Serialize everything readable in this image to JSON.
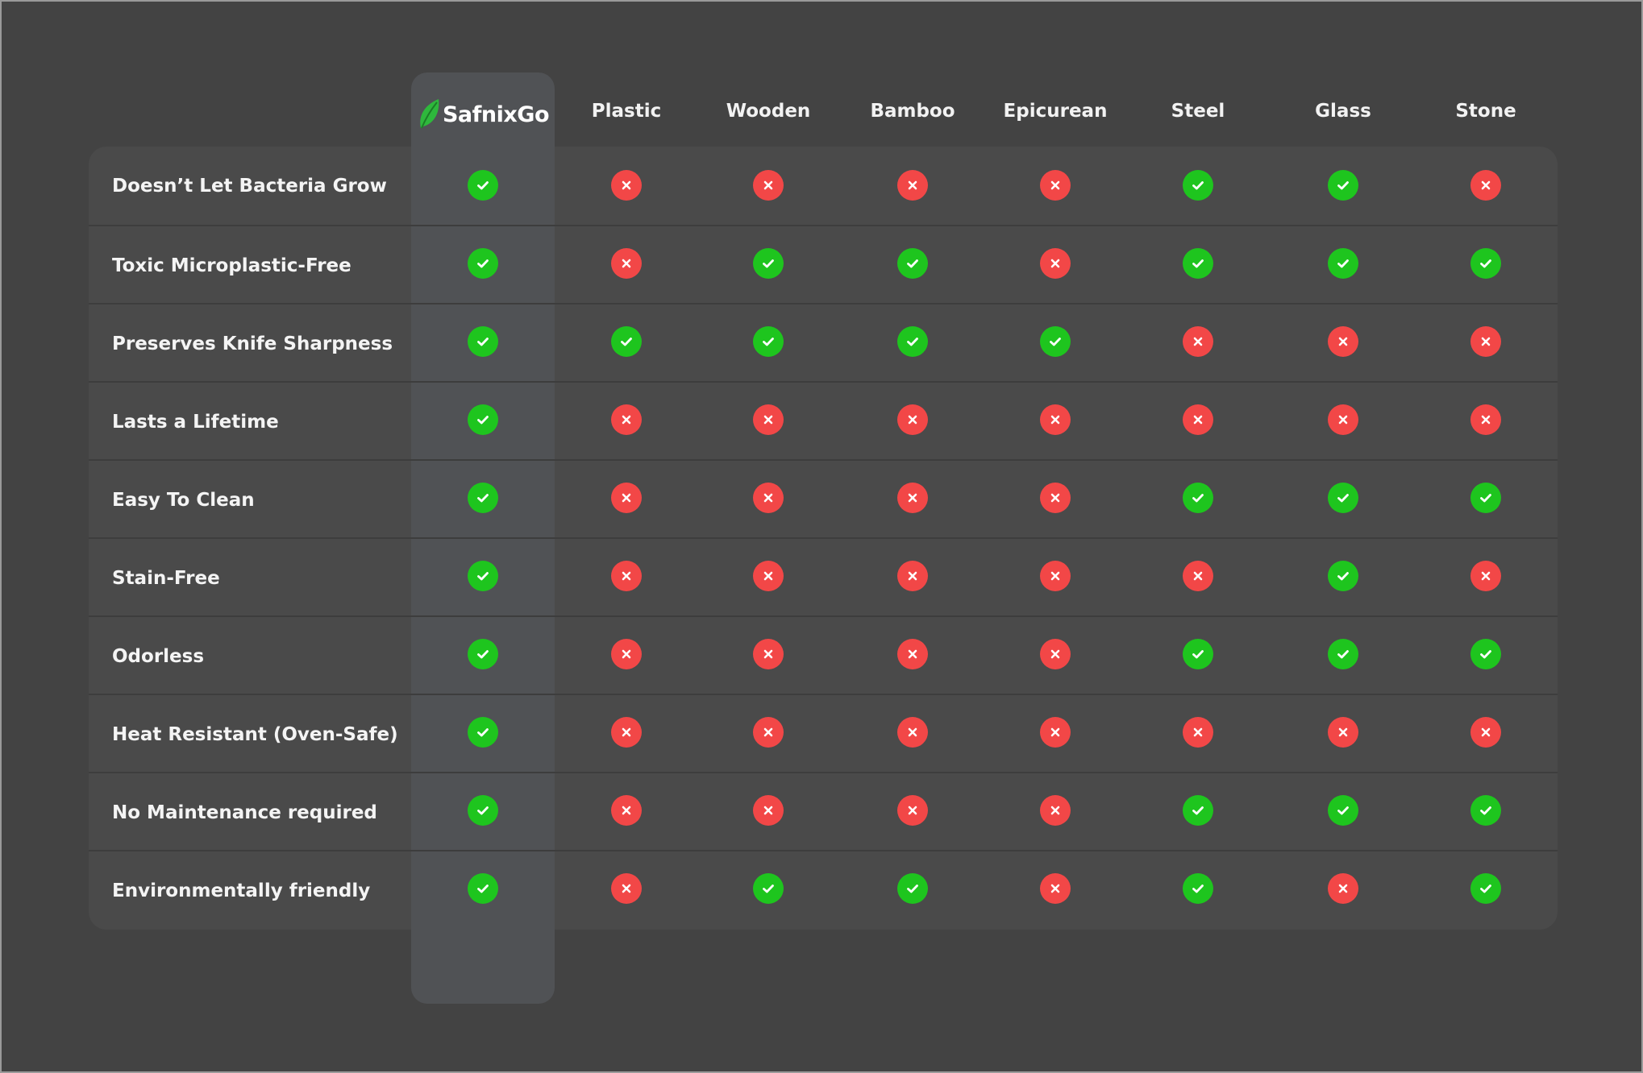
{
  "brand": {
    "name": "SafnixGo",
    "accent_color": "#2eb83c"
  },
  "columns": [
    "SafnixGo",
    "Plastic",
    "Wooden",
    "Bamboo",
    "Epicurean",
    "Steel",
    "Glass",
    "Stone"
  ],
  "colors": {
    "check": "#1ec51e",
    "cross": "#f24747",
    "background": "#434343",
    "table": "#4a4a4a",
    "highlight_column": "#505255"
  },
  "icons": {
    "yes": "check-icon",
    "no": "cross-icon",
    "brand": "leaf-icon"
  },
  "rows": [
    {
      "feature": "Doesn’t Let Bacteria Grow",
      "values": [
        true,
        false,
        false,
        false,
        false,
        true,
        true,
        false
      ]
    },
    {
      "feature": "Toxic Microplastic-Free",
      "values": [
        true,
        false,
        true,
        true,
        false,
        true,
        true,
        true
      ]
    },
    {
      "feature": "Preserves Knife Sharpness",
      "values": [
        true,
        true,
        true,
        true,
        true,
        false,
        false,
        false
      ]
    },
    {
      "feature": "Lasts a Lifetime",
      "values": [
        true,
        false,
        false,
        false,
        false,
        false,
        false,
        false
      ]
    },
    {
      "feature": "Easy To Clean",
      "values": [
        true,
        false,
        false,
        false,
        false,
        true,
        true,
        true
      ]
    },
    {
      "feature": "Stain-Free",
      "values": [
        true,
        false,
        false,
        false,
        false,
        false,
        true,
        false
      ]
    },
    {
      "feature": "Odorless",
      "values": [
        true,
        false,
        false,
        false,
        false,
        true,
        true,
        true
      ]
    },
    {
      "feature": "Heat Resistant (Oven-Safe)",
      "values": [
        true,
        false,
        false,
        false,
        false,
        false,
        false,
        false
      ]
    },
    {
      "feature": "No Maintenance required",
      "values": [
        true,
        false,
        false,
        false,
        false,
        true,
        true,
        true
      ]
    },
    {
      "feature": "Environmentally friendly",
      "values": [
        true,
        false,
        true,
        true,
        false,
        true,
        false,
        true
      ]
    }
  ]
}
